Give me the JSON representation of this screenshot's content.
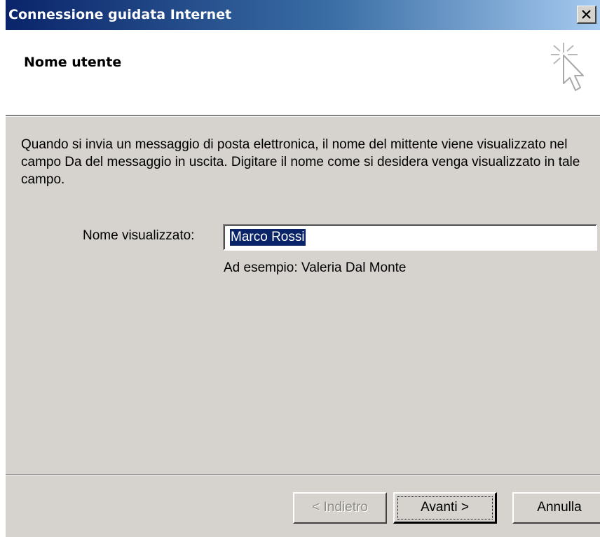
{
  "window": {
    "title": "Connessione guidata Internet",
    "close_glyph": "✕"
  },
  "header": {
    "title": "Nome utente",
    "icon": "wizard-cursor-sparkle-icon"
  },
  "body": {
    "intro": "Quando si invia un messaggio di posta elettronica, il nome del mittente viene visualizzato nel campo Da del messaggio in uscita. Digitare il nome come si desidera venga visualizzato in tale campo.",
    "display_name_label": "Nome visualizzato:",
    "display_name_value": "Marco Rossi",
    "example": "Ad esempio: Valeria Dal Monte"
  },
  "buttons": {
    "back": "< Indietro",
    "next": "Avanti >",
    "cancel": "Annulla"
  },
  "colors": {
    "titlebar_start": "#0a246a",
    "titlebar_end": "#a6caf0",
    "dialog_bg": "#d6d3ce",
    "selection": "#0a246a"
  }
}
